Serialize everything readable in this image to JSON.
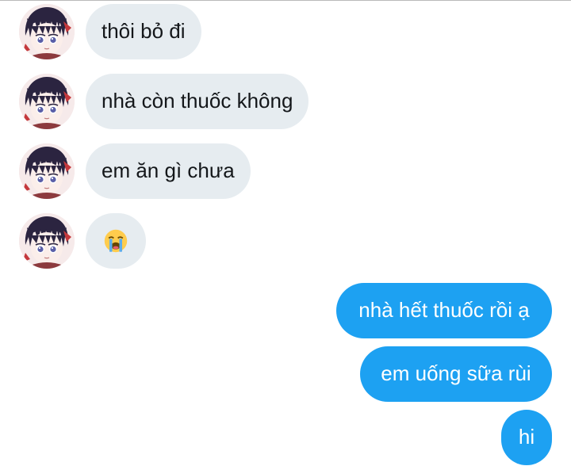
{
  "conversation": {
    "incoming": [
      {
        "text": "thôi bỏ đi"
      },
      {
        "text": "nhà còn thuốc không"
      },
      {
        "text": "em ăn gì chưa"
      },
      {
        "emoji": "loudly-crying-face"
      }
    ],
    "outgoing": [
      {
        "text": "nhà hết thuốc rồi ạ"
      },
      {
        "text": "em uống sữa rùi"
      },
      {
        "text": "hi"
      }
    ]
  },
  "colors": {
    "incoming_bubble": "#e6ecf0",
    "outgoing_bubble": "#1da1f2",
    "incoming_text": "#14171a",
    "outgoing_text": "#ffffff"
  }
}
